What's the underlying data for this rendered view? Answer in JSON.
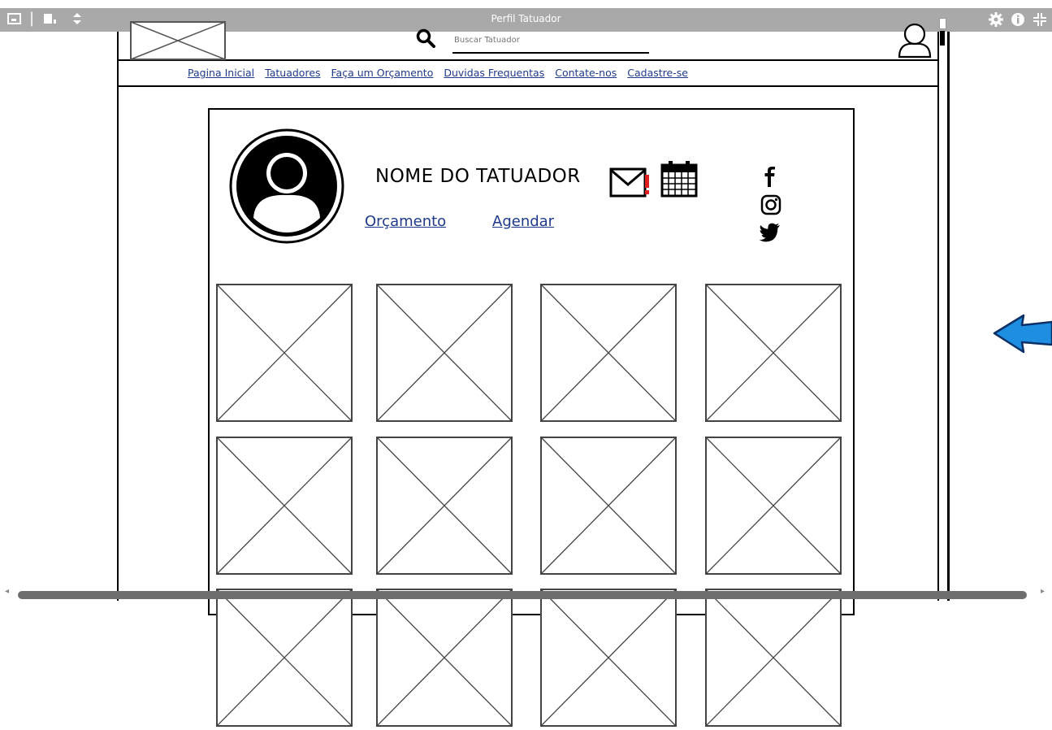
{
  "viewer": {
    "title": "Perfil Tatuador",
    "left_icons": [
      "window-icon",
      "pages-icon",
      "sort-icon"
    ],
    "right_icons": [
      "gear-icon",
      "info-icon",
      "fullscreen-icon"
    ]
  },
  "header": {
    "search_placeholder": "Buscar Tatuador"
  },
  "nav": {
    "items": [
      "Pagina Inicial",
      "Tatuadores",
      "Faça um Orçamento",
      "Duvidas Frequentas",
      "Contate-nos",
      "Cadastre-se"
    ]
  },
  "profile": {
    "name": "NOME DO TATUADOR",
    "quote_link": "Orçamento",
    "schedule_link": "Agendar",
    "social": [
      "facebook-icon",
      "instagram-icon",
      "twitter-icon"
    ]
  },
  "gallery": {
    "columns": 4,
    "visible_rows": 2
  },
  "colors": {
    "link": "#1f3a8a",
    "viewer_bar": "#a9a9a9",
    "mail_alert": "#e02020",
    "arrow": "#1e8ee0"
  }
}
